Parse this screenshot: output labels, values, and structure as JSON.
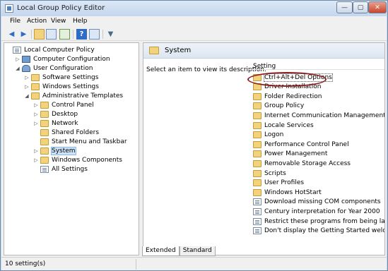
{
  "window": {
    "title": "Local Group Policy Editor"
  },
  "menu": [
    "File",
    "Action",
    "View",
    "Help"
  ],
  "tree": [
    {
      "label": "Local Computer Policy",
      "depth": 0,
      "expander": "",
      "icon": "doc"
    },
    {
      "label": "Computer Configuration",
      "depth": 1,
      "expander": "▷",
      "icon": "computer"
    },
    {
      "label": "User Configuration",
      "depth": 1,
      "expander": "◢",
      "icon": "user"
    },
    {
      "label": "Software Settings",
      "depth": 2,
      "expander": "▷",
      "icon": "folder"
    },
    {
      "label": "Windows Settings",
      "depth": 2,
      "expander": "▷",
      "icon": "folder"
    },
    {
      "label": "Administrative Templates",
      "depth": 2,
      "expander": "◢",
      "icon": "folder"
    },
    {
      "label": "Control Panel",
      "depth": 3,
      "expander": "▷",
      "icon": "folder"
    },
    {
      "label": "Desktop",
      "depth": 3,
      "expander": "▷",
      "icon": "folder"
    },
    {
      "label": "Network",
      "depth": 3,
      "expander": "▷",
      "icon": "folder"
    },
    {
      "label": "Shared Folders",
      "depth": 3,
      "expander": "",
      "icon": "folder"
    },
    {
      "label": "Start Menu and Taskbar",
      "depth": 3,
      "expander": "",
      "icon": "folder"
    },
    {
      "label": "System",
      "depth": 3,
      "expander": "▷",
      "icon": "folder",
      "selected": true
    },
    {
      "label": "Windows Components",
      "depth": 3,
      "expander": "▷",
      "icon": "folder"
    },
    {
      "label": "All Settings",
      "depth": 3,
      "expander": "",
      "icon": "doc"
    }
  ],
  "right": {
    "header_title": "System",
    "description": "Select an item to view its description.",
    "column_header": "Setting",
    "items": [
      {
        "label": "Ctrl+Alt+Del Options",
        "icon": "folder",
        "highlighted": true
      },
      {
        "label": "Driver Installation",
        "icon": "folder"
      },
      {
        "label": "Folder Redirection",
        "icon": "folder"
      },
      {
        "label": "Group Policy",
        "icon": "folder"
      },
      {
        "label": "Internet Communication Management",
        "icon": "folder"
      },
      {
        "label": "Locale Services",
        "icon": "folder"
      },
      {
        "label": "Logon",
        "icon": "folder"
      },
      {
        "label": "Performance Control Panel",
        "icon": "folder"
      },
      {
        "label": "Power Management",
        "icon": "folder"
      },
      {
        "label": "Removable Storage Access",
        "icon": "folder"
      },
      {
        "label": "Scripts",
        "icon": "folder"
      },
      {
        "label": "User Profiles",
        "icon": "folder"
      },
      {
        "label": "Windows HotStart",
        "icon": "folder"
      },
      {
        "label": "Download missing COM components",
        "icon": "doc"
      },
      {
        "label": "Century interpretation for Year 2000",
        "icon": "doc"
      },
      {
        "label": "Restrict these programs from being launch",
        "icon": "doc"
      },
      {
        "label": "Don't display the Getting Started welcome",
        "icon": "doc"
      }
    ]
  },
  "tabs": [
    {
      "label": "Extended",
      "active": true
    },
    {
      "label": "Standard",
      "active": false
    }
  ],
  "status": "10 setting(s)",
  "colors": {
    "annotation_ellipse": "#8e1f1f",
    "folder": "#f3d27c"
  }
}
